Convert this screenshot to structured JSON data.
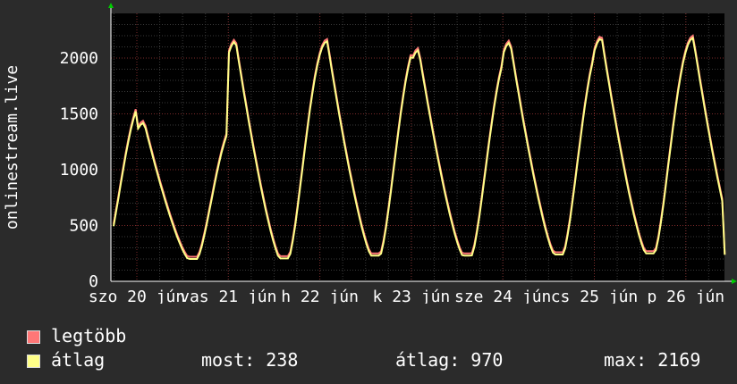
{
  "chart_data": {
    "type": "line",
    "ylabel": "onlinestream.live",
    "ylim": [
      0,
      2400
    ],
    "yticks": [
      0,
      500,
      1000,
      1500,
      2000
    ],
    "ytick_labels": [
      "0",
      "500",
      "1000",
      "1500",
      "2000"
    ],
    "xtick_labels": [
      "szo 20 jún",
      "vas 21 jún",
      "h 22 jún",
      "k 23 jún",
      "sze 24 jún",
      "cs 25 jún",
      "p 26 jún"
    ],
    "grid": true,
    "x": [
      0,
      0.25,
      0.5,
      0.75,
      1,
      1.25,
      1.5,
      1.75,
      2,
      2.25,
      2.5,
      2.75,
      3,
      3.25,
      3.5,
      3.75,
      4,
      4.25,
      4.5,
      4.75,
      5,
      5.25,
      5.5,
      5.75,
      6,
      6.25,
      6.5,
      6.75,
      7,
      7.25,
      7.5,
      7.75,
      8,
      8.25,
      8.5,
      8.75,
      9,
      9.25,
      9.5,
      9.75,
      10,
      10.25,
      10.5,
      10.75,
      11,
      11.25,
      11.5,
      11.75,
      12,
      12.25,
      12.5,
      12.75,
      13,
      13.25,
      13.5,
      13.75,
      14,
      14.25,
      14.5,
      14.75,
      15,
      15.25,
      15.5,
      15.75,
      16,
      16.25,
      16.5,
      16.75,
      17,
      17.25,
      17.5,
      17.75,
      18,
      18.25,
      18.5,
      18.75,
      19,
      19.25,
      19.5,
      19.75,
      20,
      20.25,
      20.5,
      20.75,
      21,
      21.25,
      21.5,
      21.75,
      22,
      22.25,
      22.5,
      22.75,
      23,
      23.25,
      23.5,
      23.75,
      24,
      24.25,
      24.5,
      24.75,
      25,
      25.25,
      25.5,
      25.75,
      26,
      26.25,
      26.5,
      26.75,
      27,
      27.25,
      27.5,
      27.75,
      28,
      28.25,
      28.5,
      28.75,
      29,
      29.25,
      29.5,
      29.75,
      30,
      30.25,
      30.5,
      30.75,
      31,
      31.25,
      31.5,
      31.75,
      32,
      32.25,
      32.5,
      32.75,
      33,
      33.25,
      33.5,
      33.75,
      34,
      34.25,
      34.5,
      34.75,
      35,
      35.25,
      35.5,
      35.75,
      36,
      36.25,
      36.5,
      36.75,
      37,
      37.25,
      37.5,
      37.75,
      38,
      38.25,
      38.5,
      38.75,
      39,
      39.25,
      39.5,
      39.75,
      40,
      40.25,
      40.5,
      40.75,
      41,
      41.25,
      41.5,
      41.75,
      42,
      42.25,
      42.5,
      42.75,
      43,
      43.25,
      43.5,
      43.75,
      44,
      44.25,
      44.5,
      44.75,
      45,
      45.25,
      45.5,
      45.75,
      46,
      46.25,
      46.5,
      46.75,
      47,
      47.25,
      47.5,
      47.75,
      48,
      48.25,
      48.5,
      48.75,
      49,
      49.25,
      49.5,
      49.75,
      50,
      50.25,
      50.5,
      50.75,
      51,
      51.25,
      51.5,
      51.75,
      52,
      52.25,
      52.5,
      52.75,
      53,
      53.25,
      53.5,
      53.75,
      54,
      54.25,
      54.5,
      54.75,
      55,
      55.25,
      55.5,
      55.75,
      56,
      56.25,
      56.5,
      56.75,
      57,
      57.25,
      57.5,
      57.75,
      58,
      58.25,
      58.5,
      58.75,
      59,
      59.25,
      59.5,
      59.75,
      60,
      60.25,
      60.5,
      60.75,
      61,
      61.25,
      61.5,
      61.75,
      62,
      62.25,
      62.5,
      62.75,
      63,
      63.25,
      63.5,
      63.75,
      64,
      64.25,
      64.5,
      64.75,
      65,
      65.25,
      65.5,
      65.75,
      66,
      66.25,
      66.5,
      66.75,
      67,
      67.25,
      67.5,
      67.75,
      68,
      68.25,
      68.5,
      68.75,
      69,
      69.25,
      69.5,
      69.75,
      70,
      70.25,
      70.5,
      70.75,
      71,
      71.25,
      71.5,
      71.75,
      72,
      72.25,
      72.5,
      72.75,
      73,
      73.25,
      73.5,
      73.75,
      74,
      74.25,
      74.5,
      74.75,
      75,
      75.25,
      75.5,
      75.75,
      76,
      76.25,
      76.5,
      76.75,
      77,
      77.25,
      77.5,
      77.75,
      78,
      78.25,
      78.5,
      78.75,
      79,
      79.25,
      79.5,
      79.75,
      80,
      80.25,
      80.5,
      80.75,
      81,
      81.25,
      81.5,
      81.75,
      82,
      82.25,
      82.5,
      82.75,
      83,
      83.25,
      83.5,
      83.75,
      84,
      84.25,
      84.5,
      84.75,
      85,
      85.25,
      85.5,
      85.75,
      86,
      86.25,
      86.5,
      86.75,
      87,
      87.25,
      87.5,
      87.75,
      88,
      88.25,
      88.5,
      88.75,
      89,
      89.25,
      89.5,
      89.75,
      90,
      90.25,
      90.5,
      90.75,
      91,
      91.25,
      91.5,
      91.75,
      92,
      92.25,
      92.5,
      92.75,
      93,
      93.25,
      93.5,
      93.75,
      94,
      94.25,
      94.5,
      94.75,
      95,
      95.25,
      95.5,
      95.75,
      96,
      96.25,
      96.5,
      96.75,
      97,
      97.25,
      97.5,
      97.75,
      98,
      98.25,
      98.5,
      98.75,
      99,
      99.25,
      99.5,
      99.75,
      100,
      100.25,
      100.5,
      100.75,
      101,
      101.25,
      101.5,
      101.75,
      102,
      102.25,
      102.5,
      102.75,
      103,
      103.25,
      103.5,
      103.75,
      104,
      104.25,
      104.5,
      104.75,
      105,
      105.25,
      105.5,
      105.75,
      106,
      106.25,
      106.5,
      106.75,
      107,
      107.25,
      107.5,
      107.75,
      108,
      108.25,
      108.5,
      108.75,
      109,
      109.25,
      109.5,
      109.75,
      110,
      110.25,
      110.5,
      110.75,
      111,
      111.25,
      111.5,
      111.75,
      112,
      112.25,
      112.5,
      112.75,
      113,
      113.25,
      113.5,
      113.75,
      114,
      114.25,
      114.5,
      114.75,
      115,
      115.25,
      115.5,
      115.75,
      116,
      116.25,
      116.5,
      116.75,
      117,
      117.25,
      117.5,
      117.75,
      118,
      118.25,
      118.5,
      118.75,
      119,
      119.25,
      119.5,
      119.75,
      120,
      120.25,
      120.5,
      120.75,
      121,
      121.25,
      121.5,
      121.75,
      122,
      122.25,
      122.5,
      122.75,
      123,
      123.25,
      123.5,
      123.75,
      124,
      124.25,
      124.5,
      124.75,
      125,
      125.25,
      125.5,
      125.75,
      126,
      126.25,
      126.5,
      126.75,
      127,
      127.25,
      127.5,
      127.75,
      128,
      128.25,
      128.5,
      128.75,
      129,
      129.25,
      129.5,
      129.75,
      130,
      130.25,
      130.5,
      130.75,
      131,
      131.25,
      131.5,
      131.75,
      132,
      132.25,
      132.5,
      132.75,
      133,
      133.25,
      133.5,
      133.75,
      134,
      134.25,
      134.5,
      134.75,
      135,
      135.25,
      135.5,
      135.75,
      136,
      136.25,
      136.5,
      136.75,
      137,
      137.25,
      137.5,
      137.75,
      138,
      138.25,
      138.5,
      138.75,
      139,
      139.25,
      139.5,
      139.75,
      140,
      140.25,
      140.5,
      140.75,
      141,
      141.25,
      141.5,
      141.75,
      142,
      142.25,
      142.5,
      142.75,
      143,
      143.25,
      143.5,
      143.75,
      144,
      144.25,
      144.5,
      144.75,
      145,
      145.25,
      145.5,
      145.75,
      146,
      146.25,
      146.5,
      146.75,
      147,
      147.25,
      147.5,
      147.75,
      148,
      148.25,
      148.5,
      148.75,
      149,
      149.25,
      149.5,
      149.75,
      150,
      150.25,
      150.5,
      150.75,
      151,
      151.25,
      151.5,
      151.75,
      152,
      152.25,
      152.5,
      152.75,
      153,
      153.25,
      153.5,
      153.75,
      154,
      154.25,
      154.5,
      154.75,
      155,
      155.25,
      155.5,
      155.75,
      156,
      156.25,
      156.5,
      156.75,
      157,
      157.25,
      157.5,
      157.75,
      158,
      158.25,
      158.5,
      158.75,
      159,
      159.25,
      159.5,
      159.75,
      160,
      160.25,
      160.5,
      160.75,
      161,
      161.25,
      161.5,
      161.75,
      162,
      162.25,
      162.5,
      162.75,
      163,
      163.25,
      163.5,
      163.75,
      164,
      164.25,
      164.5,
      164.75,
      165,
      165.25,
      165.5,
      165.75,
      166,
      166.25,
      166.5,
      166.75,
      167,
      167.25,
      167.5,
      167.75,
      168,
      168.25,
      168.5,
      168.75,
      169,
      169.25,
      169.5,
      169.75,
      170,
      170.25,
      170.5,
      170.75,
      171,
      171.25,
      171.5,
      171.75,
      172,
      172.25,
      172.5,
      172.75,
      173,
      173.25,
      173.5,
      173.75,
      174,
      174.25,
      174.5,
      174.75,
      175,
      175.25,
      175.5,
      175.75,
      176,
      176.25,
      176.5,
      176.75,
      177,
      177.25,
      177.5,
      177.75,
      178,
      178.25,
      178.5,
      178.75,
      179,
      179.25,
      179.5,
      179.75,
      180,
      180.25,
      180.5,
      180.75,
      181,
      181.25,
      181.5,
      181.75,
      182,
      182.25,
      182.5,
      182.75,
      183,
      183.25,
      183.5,
      183.75,
      184,
      184.25,
      184.5,
      184.75,
      185,
      185.25,
      185.5,
      185.75,
      186,
      186.25,
      186.5,
      186.75,
      187,
      187.25,
      187.5,
      187.75,
      188,
      188.25,
      188.5,
      188.75,
      189,
      189.25,
      189.5,
      189.75,
      190,
      190.25,
      190.5,
      190.75,
      191,
      191.25,
      191.5,
      191.75,
      192,
      192.25,
      192.5,
      192.75,
      193,
      193.25,
      193.5,
      193.75,
      194,
      194.25,
      194.5,
      194.75,
      195,
      195.25,
      195.5,
      195.75,
      196,
      196.25,
      196.5,
      196.75,
      197,
      197.25,
      197.5,
      197.75,
      198,
      198.25,
      198.5,
      198.75,
      199,
      199.25,
      199.5,
      199.75,
      200,
      200.25,
      200.5,
      200.75,
      201,
      201.25,
      201.5,
      201.75,
      202,
      202.25,
      202.5,
      202.75,
      203,
      203.25,
      203.5,
      203.75,
      204,
      204.25,
      204.5,
      204.75,
      205,
      205.25,
      205.5,
      205.75,
      206,
      206.25,
      206.5,
      206.75,
      207,
      207.25,
      207.5,
      207.75,
      208,
      208.25,
      208.5,
      208.75,
      209,
      209.25,
      209.5,
      209.75,
      210,
      210.25,
      210.5,
      210.75,
      211,
      211.25,
      211.5,
      211.75,
      212,
      212.25,
      212.5,
      212.75,
      213,
      213.25,
      213.5,
      213.75,
      214,
      214.25,
      214.5,
      214.75,
      215,
      215.25,
      215.5,
      215.75,
      216,
      216.25,
      216.5,
      216.75,
      217,
      217.25,
      217.5,
      217.75,
      218,
      218.25,
      218.5,
      218.75,
      219,
      219.25,
      219.5,
      219.75,
      220,
      220.25,
      220.5,
      220.75,
      221,
      221.25,
      221.5,
      221.75,
      222,
      222.25,
      222.5,
      222.75,
      223,
      223.25,
      223.5,
      223.75,
      224,
      224.25,
      224.5,
      224.75,
      225,
      225.25,
      225.5,
      225.75,
      226,
      226.25,
      226.5,
      226.75,
      227,
      227.25,
      227.5,
      227.75,
      228,
      228.25,
      228.5,
      228.75,
      229,
      229.25,
      229.5,
      229.75,
      230,
      230.25,
      230.5,
      230.75,
      231,
      231.25,
      231.5,
      231.75,
      232,
      232.25,
      232.5,
      232.75,
      233,
      233.25,
      233.5,
      233.75,
      234,
      234.25,
      234.5,
      234.75,
      235,
      235.25,
      235.5,
      235.75,
      236,
      236.25,
      236.5,
      236.75,
      237,
      237.25,
      237.5,
      237.75,
      238,
      238.25,
      238.5,
      238.75,
      239,
      239.25,
      239.5,
      239.75,
      240,
      240.25,
      240.5,
      240.75,
      241,
      241.25,
      241.5,
      241.75,
      242,
      242.25,
      242.5,
      242.75,
      243,
      243.25,
      243.5,
      243.75,
      244,
      244.25,
      244.5,
      244.75,
      245,
      245.25,
      245.5,
      245.75,
      246,
      246.25,
      246.5,
      246.75,
      247,
      247.25,
      247.5,
      247.75,
      248,
      248.25,
      248.5,
      248.75,
      249,
      249.25,
      249.5,
      249.75
    ],
    "x_note_marker": "hours",
    "series": [
      {
        "name": "legtöbb",
        "color": "#ff7777",
        "values": []
      },
      {
        "name": "átlag",
        "color": "#ffff88",
        "values": []
      }
    ]
  },
  "legend": {
    "max_label": "legtöbb",
    "avg_label": "átlag",
    "max_color": "#ff7777",
    "avg_color": "#ffff88"
  },
  "stats": {
    "now": "most: 238",
    "avg": "átlag: 970",
    "max": "max: 2169"
  }
}
